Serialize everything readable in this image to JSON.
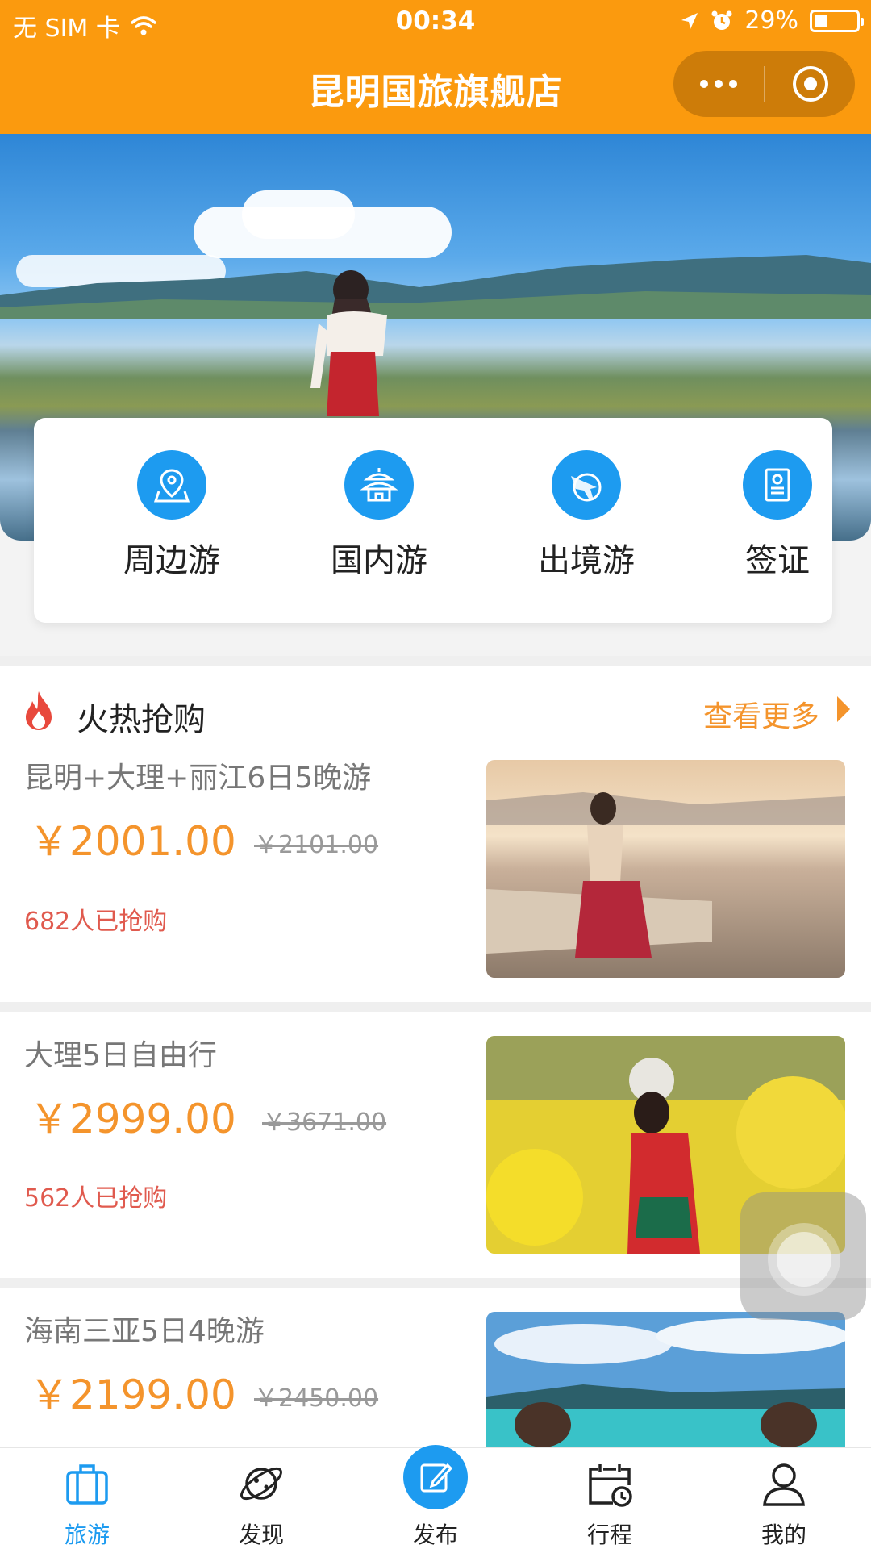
{
  "status_bar": {
    "carrier": "无 SIM 卡",
    "time": "00:34",
    "battery": "29%"
  },
  "header": {
    "title": "昆明国旅旗舰店"
  },
  "categories": [
    {
      "label": "周边游",
      "icon": "map-pin-icon"
    },
    {
      "label": "国内游",
      "icon": "temple-icon"
    },
    {
      "label": "出境游",
      "icon": "plane-globe-icon"
    },
    {
      "label": "签证",
      "icon": "passport-icon"
    }
  ],
  "section": {
    "title": "火热抢购",
    "more": "查看更多"
  },
  "products": [
    {
      "name": "昆明+大理+丽江6日5晚游",
      "price": "￥2001.00",
      "original_price": "￥2101.00",
      "sold": "682人已抢购"
    },
    {
      "name": "大理5日自由行",
      "price": "￥2999.00",
      "original_price": "￥3671.00",
      "sold": "562人已抢购"
    },
    {
      "name": "海南三亚5日4晚游",
      "price": "￥2199.00",
      "original_price": "￥2450.00"
    }
  ],
  "tabs": [
    {
      "label": "旅游",
      "icon": "suitcase-icon",
      "active": true
    },
    {
      "label": "发现",
      "icon": "planet-icon"
    },
    {
      "label": "发布",
      "icon": "edit-icon"
    },
    {
      "label": "行程",
      "icon": "calendar-clock-icon"
    },
    {
      "label": "我的",
      "icon": "user-icon"
    }
  ],
  "colors": {
    "brand_orange": "#fb9a0e",
    "accent_blue": "#1d9bf0",
    "price_orange": "#f4942c",
    "sold_red": "#e05a4e"
  }
}
